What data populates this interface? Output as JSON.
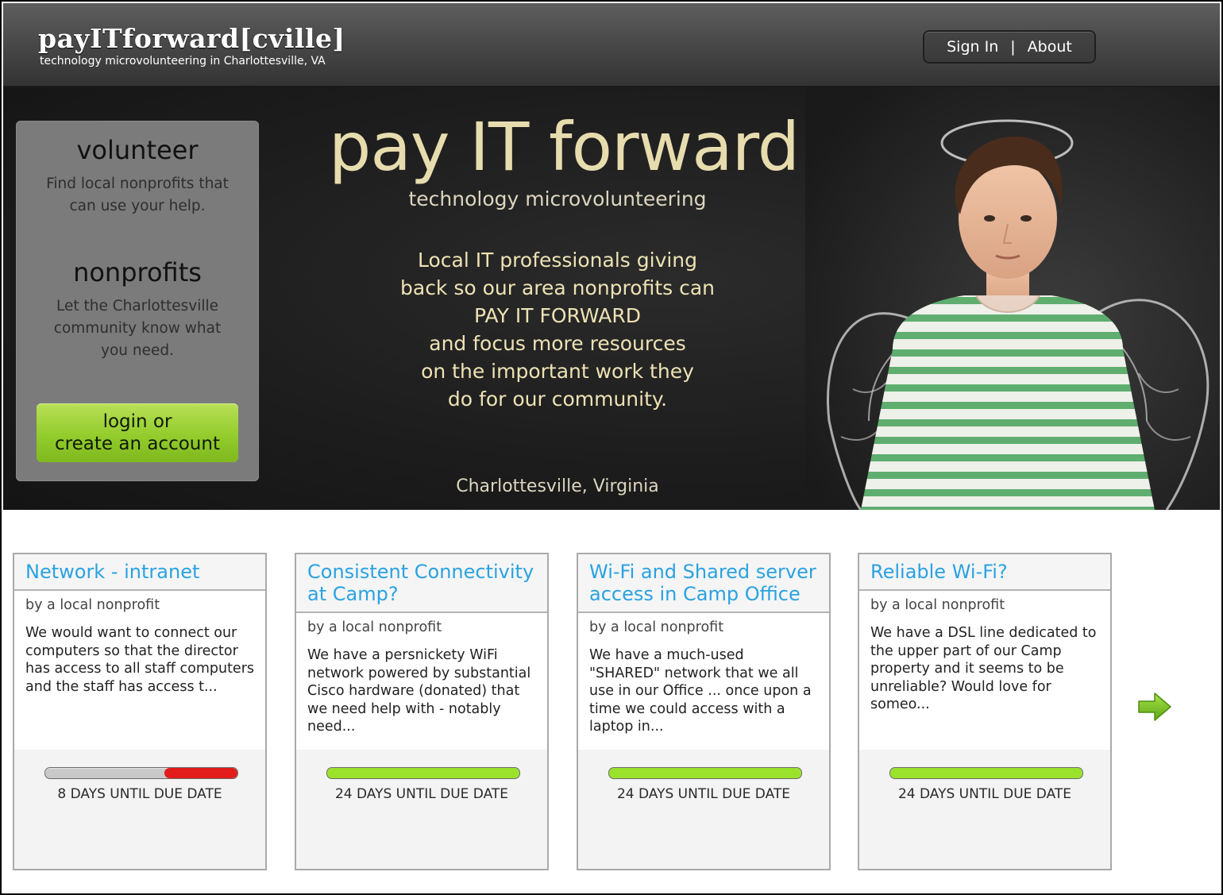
{
  "header": {
    "brand": "payITforward[cville]",
    "tagline": "technology microvolunteering in Charlottesville, VA",
    "nav": {
      "sign_in": "Sign In",
      "separator": "|",
      "about": "About"
    }
  },
  "sidebar": {
    "volunteer_heading": "volunteer",
    "volunteer_text": "Find local nonprofits that can use your help.",
    "nonprofits_heading": "nonprofits",
    "nonprofits_text": "Let the Charlottesville community know what you need.",
    "login_line1": "login or",
    "login_line2": "create an account"
  },
  "hero": {
    "title": "pay IT forward",
    "subtitle": "technology microvolunteering",
    "body_lines": [
      "Local IT professionals giving",
      "back so our area nonprofits can",
      "PAY IT FORWARD",
      "and focus more resources",
      "on the important work they",
      "do for our community."
    ],
    "location": "Charlottesville, Virginia"
  },
  "requests": [
    {
      "title": "Network - intranet",
      "by": "by a local nonprofit",
      "text": "We would want to connect our computers so that the director has access to all staff computers and the staff has access t...",
      "days": "8",
      "due_label": "DAYS UNTIL DUE DATE",
      "progress_fraction": 0.62,
      "bar_color": "#e21b1b",
      "track_color": "#c9c9c9"
    },
    {
      "title": "Consistent Connectivity at Camp?",
      "by": "by a local nonprofit",
      "text": "We have a persnickety WiFi network powered by substantial Cisco hardware (donated) that we need help with - notably need...",
      "days": "24",
      "due_label": "DAYS UNTIL DUE DATE",
      "progress_fraction": 0.0,
      "bar_color": "#9be22d",
      "track_color": "#9be22d"
    },
    {
      "title": "Wi-Fi and Shared server access in Camp Office",
      "by": "by a local nonprofit",
      "text": "We have a much-used \"SHARED\" network that we all use in our Office ... once upon a time we could access with a laptop in...",
      "days": "24",
      "due_label": "DAYS UNTIL DUE DATE",
      "progress_fraction": 0.0,
      "bar_color": "#9be22d",
      "track_color": "#9be22d"
    },
    {
      "title": "Reliable Wi-Fi?",
      "by": "by a local nonprofit",
      "text": "We have a DSL line dedicated to the upper part of our Camp property and it seems to be unreliable? Would love for someo...",
      "days": "24",
      "due_label": "DAYS UNTIL DUE DATE",
      "progress_fraction": 0.0,
      "bar_color": "#9be22d",
      "track_color": "#9be22d"
    }
  ],
  "icons": {
    "next": "arrow-right-icon",
    "arrow_color": "#7cc41f"
  }
}
